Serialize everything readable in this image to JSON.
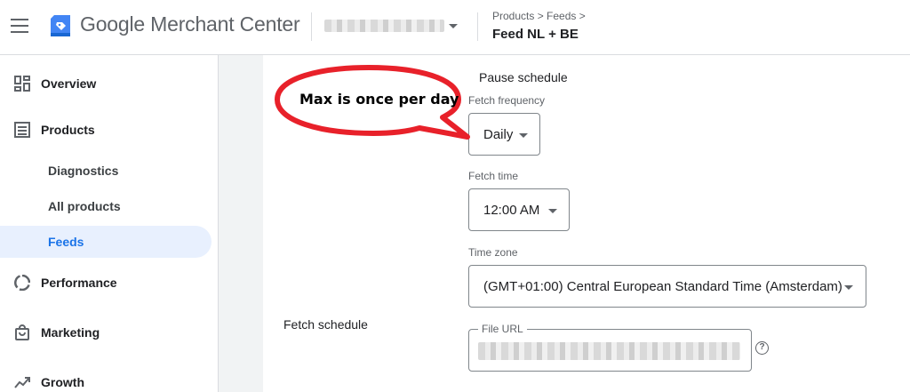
{
  "header": {
    "app_name": "Google Merchant Center",
    "breadcrumb": "Products > Feeds >",
    "feed_title": "Feed NL + BE",
    "brand_color": "#4285f4"
  },
  "sidebar": {
    "items": [
      {
        "label": "Overview",
        "icon": "overview-dashboard-icon"
      },
      {
        "label": "Products",
        "icon": "products-list-icon"
      },
      {
        "label": "Diagnostics"
      },
      {
        "label": "All products"
      },
      {
        "label": "Feeds",
        "active": true
      },
      {
        "label": "Performance",
        "icon": "performance-ring-icon"
      },
      {
        "label": "Marketing",
        "icon": "marketing-bag-icon"
      },
      {
        "label": "Growth",
        "icon": "growth-trend-icon"
      }
    ],
    "active_color": "#1a73e8",
    "active_bg": "#e8f0fe"
  },
  "main": {
    "pause_label": "Pause schedule",
    "fetch_frequency": {
      "label": "Fetch frequency",
      "value": "Daily"
    },
    "fetch_time": {
      "label": "Fetch time",
      "value": "12:00 AM"
    },
    "time_zone": {
      "label": "Time zone",
      "value": "(GMT+01:00) Central European Standard Time (Amsterdam)"
    },
    "section_label": "Fetch schedule",
    "file_url": {
      "label": "File URL"
    },
    "help_glyph": "?"
  },
  "annotation": {
    "text": "Max is once per day",
    "color": "#e8212a"
  }
}
